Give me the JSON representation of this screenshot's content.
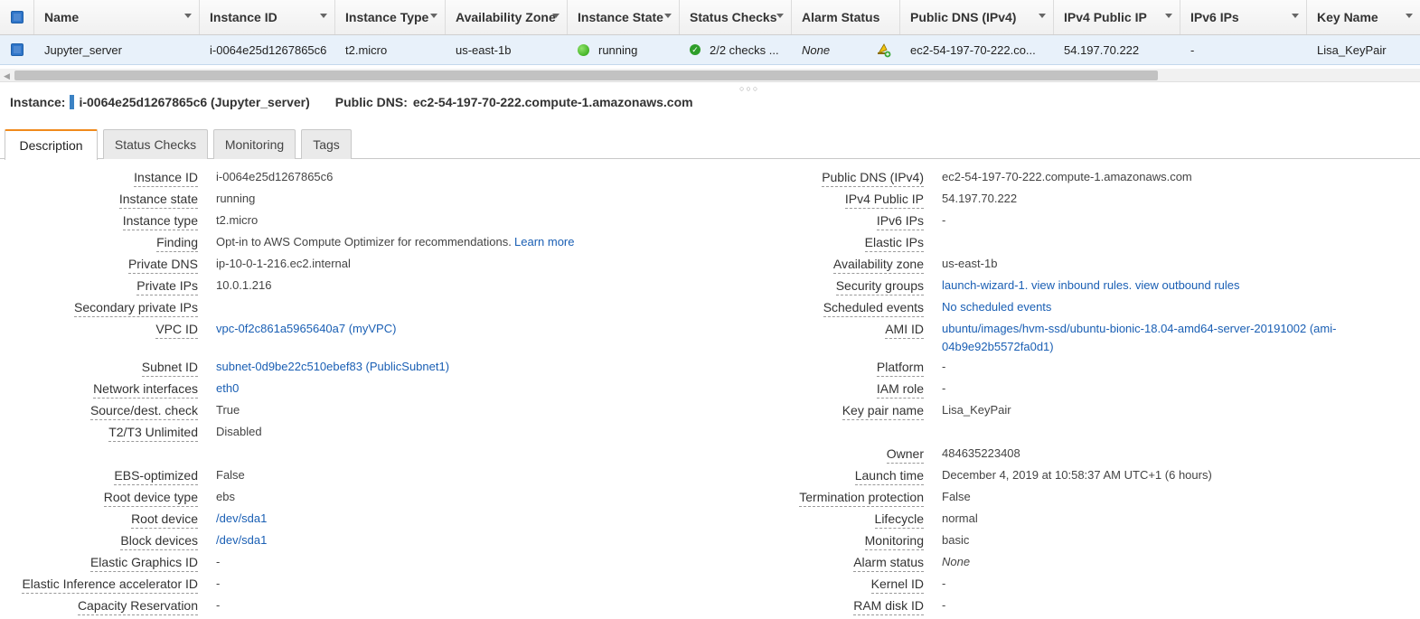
{
  "grid": {
    "headers": [
      {
        "label": "Name"
      },
      {
        "label": "Instance ID"
      },
      {
        "label": "Instance Type"
      },
      {
        "label": "Availability Zone"
      },
      {
        "label": "Instance State"
      },
      {
        "label": "Status Checks"
      },
      {
        "label": "Alarm Status"
      },
      {
        "label": "Public DNS (IPv4)"
      },
      {
        "label": "IPv4 Public IP"
      },
      {
        "label": "IPv6 IPs"
      },
      {
        "label": "Key Name"
      }
    ],
    "row": {
      "name": "Jupyter_server",
      "instance_id": "i-0064e25d1267865c6",
      "instance_type": "t2.micro",
      "availability_zone": "us-east-1b",
      "instance_state": "running",
      "status_checks": "2/2 checks ...",
      "alarm_status": "None",
      "public_dns": "ec2-54-197-70-222.co...",
      "ipv4_public_ip": "54.197.70.222",
      "ipv6_ips": "-",
      "key_name": "Lisa_KeyPair"
    }
  },
  "summary": {
    "instance_label": "Instance:",
    "instance_value": "i-0064e25d1267865c6 (Jupyter_server)",
    "dns_label": "Public DNS:",
    "dns_value": "ec2-54-197-70-222.compute-1.amazonaws.com"
  },
  "tabs": [
    {
      "label": "Description"
    },
    {
      "label": "Status Checks"
    },
    {
      "label": "Monitoring"
    },
    {
      "label": "Tags"
    }
  ],
  "details_left": [
    {
      "label": "Instance ID",
      "value": "i-0064e25d1267865c6"
    },
    {
      "label": "Instance state",
      "value": "running"
    },
    {
      "label": "Instance type",
      "value": "t2.micro"
    },
    {
      "label": "Finding",
      "value": "Opt-in to AWS Compute Optimizer for recommendations.",
      "link": "Learn more"
    },
    {
      "label": "Private DNS",
      "value": "ip-10-0-1-216.ec2.internal"
    },
    {
      "label": "Private IPs",
      "value": "10.0.1.216"
    },
    {
      "label": "Secondary private IPs",
      "value": ""
    },
    {
      "label": "VPC ID",
      "value": "vpc-0f2c861a5965640a7 (myVPC)"
    },
    {
      "label": "Subnet ID",
      "value": "subnet-0d9be22c510ebef83 (PublicSubnet1)"
    },
    {
      "label": "Network interfaces",
      "value": "eth0"
    },
    {
      "label": "Source/dest. check",
      "value": "True"
    },
    {
      "label": "T2/T3 Unlimited",
      "value": "Disabled"
    },
    {
      "label": "EBS-optimized",
      "value": "False"
    },
    {
      "label": "Root device type",
      "value": "ebs"
    },
    {
      "label": "Root device",
      "value": "/dev/sda1"
    },
    {
      "label": "Block devices",
      "value": "/dev/sda1"
    },
    {
      "label": "Elastic Graphics ID",
      "value": "-"
    },
    {
      "label": "Elastic Inference accelerator ID",
      "value": "-"
    },
    {
      "label": "Capacity Reservation",
      "value": "-"
    }
  ],
  "details_right": [
    {
      "label": "Public DNS (IPv4)",
      "value": "ec2-54-197-70-222.compute-1.amazonaws.com"
    },
    {
      "label": "IPv4 Public IP",
      "value": "54.197.70.222"
    },
    {
      "label": "IPv6 IPs",
      "value": "-"
    },
    {
      "label": "Elastic IPs",
      "value": ""
    },
    {
      "label": "Availability zone",
      "value": "us-east-1b"
    },
    {
      "label": "Security groups",
      "value": "launch-wizard-1. view inbound rules. view outbound rules"
    },
    {
      "label": "Scheduled events",
      "value": "No scheduled events"
    },
    {
      "label": "AMI ID",
      "value_line1": "ubuntu/images/hvm-ssd/ubuntu-bionic-18.04-amd64-server-20191002 (ami-",
      "value_line2": "04b9e92b5572fa0d1)"
    },
    {
      "label": "Platform",
      "value": "-"
    },
    {
      "label": "IAM role",
      "value": "-"
    },
    {
      "label": "Key pair name",
      "value": "Lisa_KeyPair"
    },
    {
      "label": "Owner",
      "value": "484635223408"
    },
    {
      "label": "Launch time",
      "value": "December 4, 2019 at 10:58:37 AM UTC+1 (6 hours)"
    },
    {
      "label": "Termination protection",
      "value": "False"
    },
    {
      "label": "Lifecycle",
      "value": "normal"
    },
    {
      "label": "Monitoring",
      "value": "basic"
    },
    {
      "label": "Alarm status",
      "value": "None"
    },
    {
      "label": "Kernel ID",
      "value": "-"
    },
    {
      "label": "RAM disk ID",
      "value": "-"
    }
  ],
  "icons": {
    "header_checkbox": "checkbox-icon",
    "row_checkbox": "checkbox-icon",
    "state": "green-dot-icon",
    "checks": "check-circle-icon",
    "alarm": "alarm-bell-icon",
    "sort": "caret-down-icon"
  },
  "colors": {
    "link": "#1a5fb4",
    "selected_row": "#e8f1fa",
    "tab_accent": "#f08a1c",
    "running": "#25a00a"
  }
}
